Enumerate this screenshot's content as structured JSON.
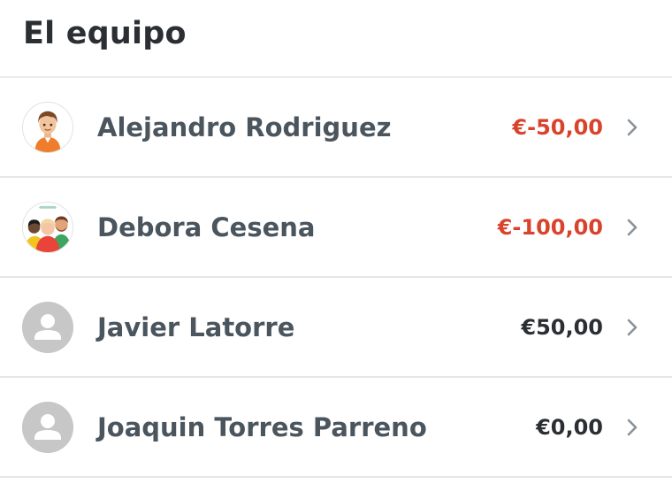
{
  "header": {
    "title": "El equipo"
  },
  "colors": {
    "negative": "#d9432c",
    "neutral": "#2b2f33",
    "chevron": "#8a9299"
  },
  "members": [
    {
      "name": "Alejandro Rodriguez",
      "balance": "€-50,00",
      "status": "negative",
      "avatar": "boy-cartoon-avatar"
    },
    {
      "name": "Debora Cesena",
      "balance": "€-100,00",
      "status": "negative",
      "avatar": "team-cartoon-avatar"
    },
    {
      "name": "Javier Latorre",
      "balance": "€50,00",
      "status": "neutral",
      "avatar": "default-user-avatar"
    },
    {
      "name": "Joaquin Torres Parreno",
      "balance": "€0,00",
      "status": "neutral",
      "avatar": "default-user-avatar"
    }
  ]
}
